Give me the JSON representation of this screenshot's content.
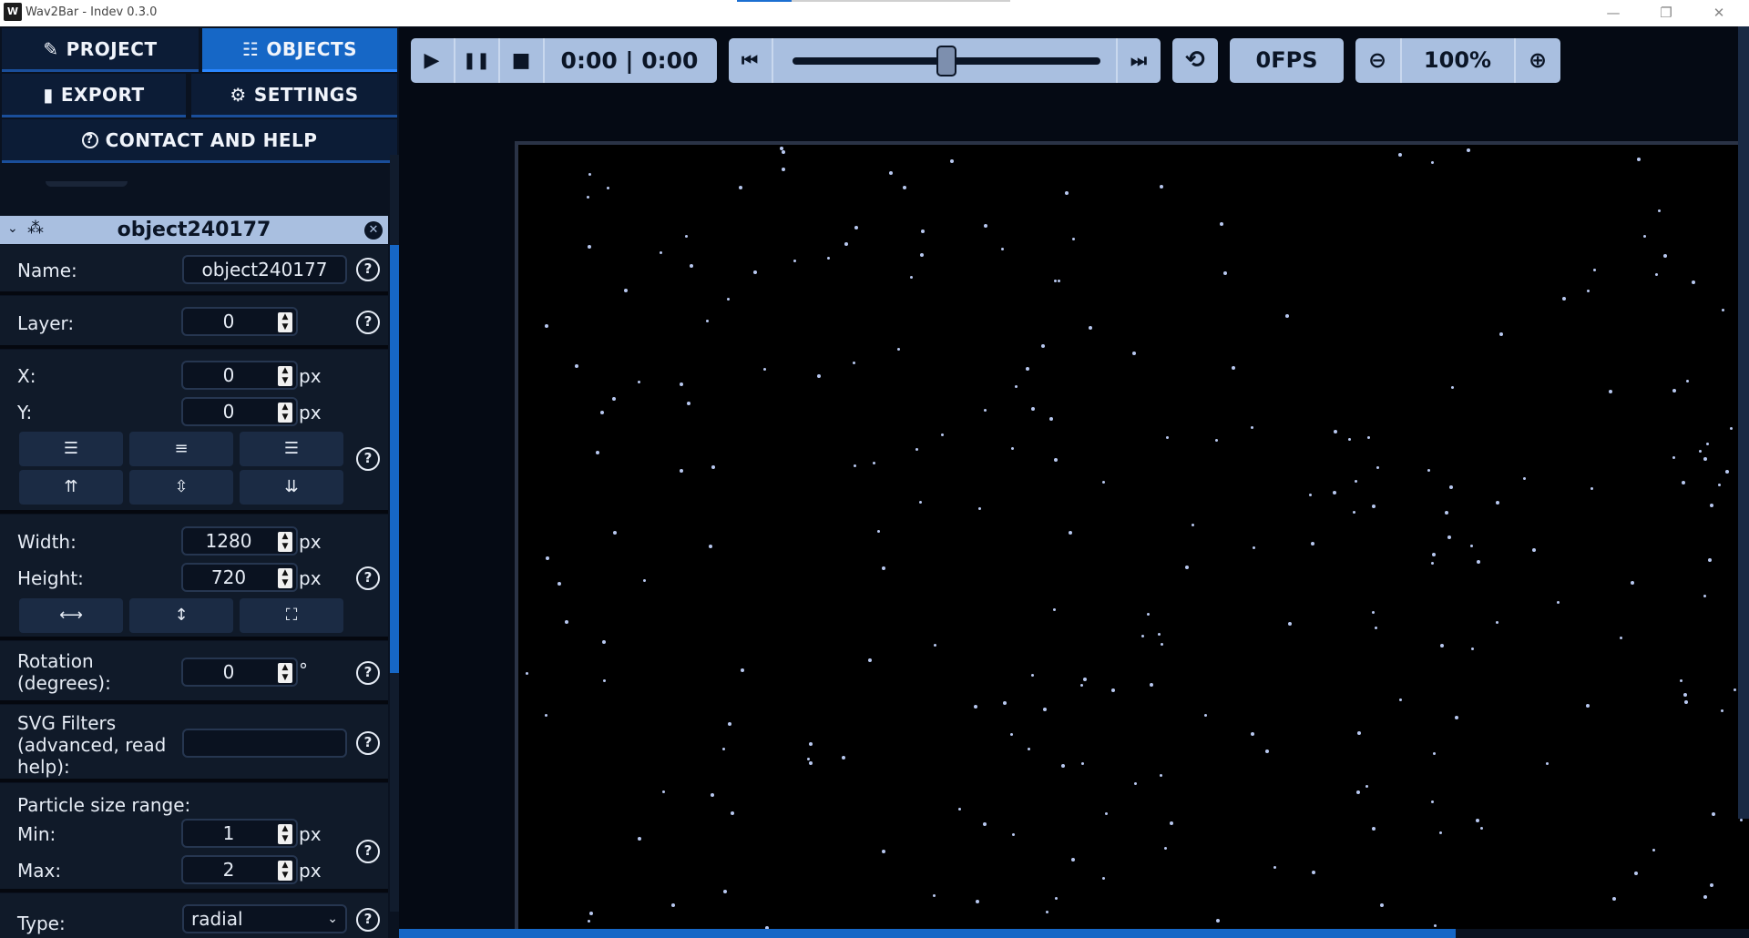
{
  "window": {
    "title": "Wav2Bar - Indev 0.3.0",
    "icon_letter": "W"
  },
  "tabs": [
    {
      "label": "PROJECT",
      "icon": "edit-icon",
      "glyph": "✎",
      "active": false
    },
    {
      "label": "OBJECTS",
      "icon": "objects-icon",
      "glyph": "☷",
      "active": true
    },
    {
      "label": "EXPORT",
      "icon": "film-icon",
      "glyph": "▮",
      "active": false
    },
    {
      "label": "SETTINGS",
      "icon": "gear-icon",
      "glyph": "⚙",
      "active": false
    },
    {
      "label": "CONTACT AND HELP",
      "icon": "help-icon",
      "glyph": "?",
      "active": false
    }
  ],
  "object": {
    "title": "object240177",
    "icon": "particles-icon",
    "name_label": "Name:",
    "name_value": "object240177",
    "layer_label": "Layer:",
    "layer_value": "0",
    "x_label": "X:",
    "x_value": "0",
    "y_label": "Y:",
    "y_value": "0",
    "px_unit": "px",
    "width_label": "Width:",
    "width_value": "1280",
    "height_label": "Height:",
    "height_value": "720",
    "rotation_label_1": "Rotation",
    "rotation_label_2": "(degrees):",
    "rotation_value": "0",
    "rotation_unit": "°",
    "svg_label_1": "SVG Filters",
    "svg_label_2": "(advanced, read",
    "svg_label_3": "help):",
    "svg_value": "",
    "particle_label": "Particle size range:",
    "min_label": "Min:",
    "min_value": "1",
    "max_label": "Max:",
    "max_value": "2",
    "type_label": "Type:",
    "type_value": "radial"
  },
  "toolbar": {
    "time_display": "0:00 | 0:00",
    "fps_display": "0FPS",
    "zoom_display": "100%",
    "seek_position": 0.5
  },
  "colors": {
    "accent": "#1667c6",
    "panel": "#101a29",
    "header": "#a9bfe0",
    "star": "#b8c8f0"
  }
}
